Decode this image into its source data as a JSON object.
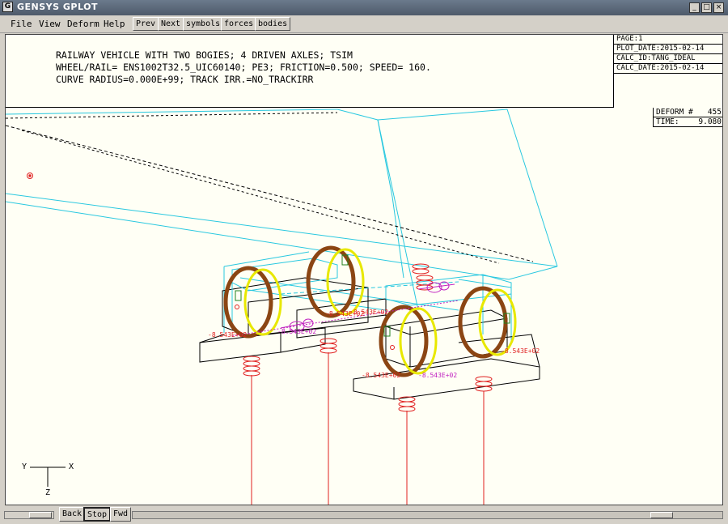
{
  "window": {
    "title": "GENSYS GPLOT"
  },
  "menu": {
    "file": "File",
    "view": "View",
    "deform": "Deform",
    "help": "Help"
  },
  "toolbar": {
    "prev": "Prev",
    "next": "Next",
    "symbols": "symbols",
    "forces": "forces",
    "bodies": "bodies"
  },
  "header": {
    "line1": "RAILWAY VEHICLE WITH TWO BOGIES; 4 DRIVEN AXLES; TSIM",
    "line2": "WHEEL/RAIL= ENS1002T32.5_UIC60140; PE3; FRICTION=0.500; SPEED= 160.",
    "line3": "CURVE RADIUS=0.000E+99; TRACK IRR.=NO_TRACKIRR"
  },
  "meta": {
    "page": "PAGE:1",
    "plot_date": "PLOT_DATE:2015-02-14",
    "calc_id": "CALC_ID:TANG_IDEAL",
    "calc_date": "CALC_DATE:2015-02-14"
  },
  "deform": {
    "label": "DEFORM #",
    "value": "455",
    "time_label": "TIME:",
    "time_value": "9.080"
  },
  "axes": {
    "y": "Y",
    "x": "X",
    "z": "Z"
  },
  "annotations": {
    "a1": "-8.543E+02",
    "a2": "-8.543E+02",
    "a3": "-8.543E+02",
    "a4": "-8.543E+02",
    "a5": "-8.543E+02",
    "a6": "-8.543E+02",
    "a7": "-8.543E+02"
  },
  "bottom": {
    "back": "Back",
    "stop": "Stop",
    "fwd": "Fwd"
  },
  "colors": {
    "cyan": "#29c8e0",
    "red": "#e02020",
    "magenta": "#c020c0",
    "yellow": "#e8e800",
    "brown": "#8b4513",
    "green": "#208020"
  }
}
